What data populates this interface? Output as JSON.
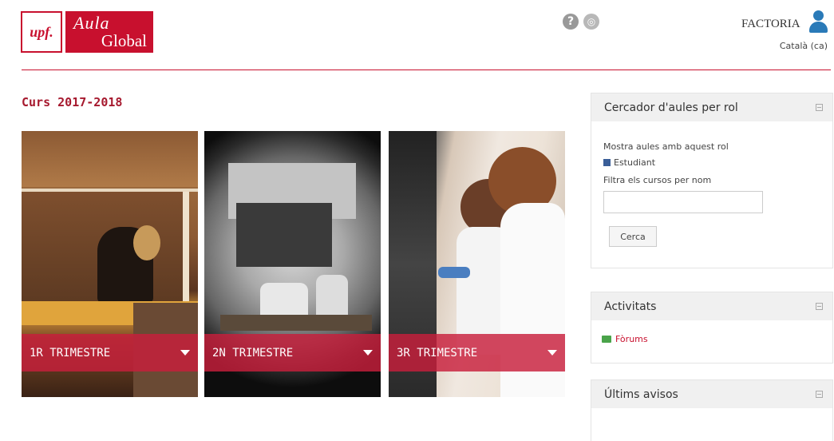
{
  "header": {
    "logo_upf": "upf.",
    "logo_aula_line1": "Aula",
    "logo_aula_line2": "Global",
    "help_icon": "help-icon",
    "support_icon": "lifebuoy-icon",
    "user_name": "FACTORIA",
    "language": "Català (ca)"
  },
  "main": {
    "course_title": "Curs 2017-2018",
    "tiles": [
      {
        "label": "1R TRIMESTRE"
      },
      {
        "label": "2N TRIMESTRE"
      },
      {
        "label": "3R TRIMESTRE"
      }
    ]
  },
  "sidebar": {
    "search_block": {
      "title": "Cercador d'aules per rol",
      "role_text": "Mostra aules amb aquest rol",
      "role_value": "Estudiant",
      "filter_label": "Filtra els cursos per nom",
      "filter_value": "",
      "button_label": "Cerca"
    },
    "activities_block": {
      "title": "Activitats",
      "forum_label": "Fòrums"
    },
    "news_block": {
      "title": "Últims avisos"
    }
  },
  "colors": {
    "brand": "#c8102e",
    "tile_bar": "#c81e3c",
    "title": "#a6192e"
  }
}
